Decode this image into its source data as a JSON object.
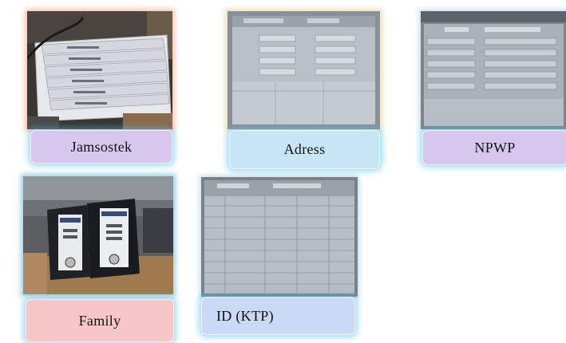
{
  "tiles": [
    {
      "label": "Jamsostek",
      "label_color": "#d7c7ee",
      "photo_icon": "document-stack-photo"
    },
    {
      "label": "Adress",
      "label_color": "#c6e6f6",
      "photo_icon": "address-form-screen-photo"
    },
    {
      "label": "NPWP",
      "label_color": "#d7c7ee",
      "photo_icon": "npwp-form-screen-photo"
    },
    {
      "label": "Family",
      "label_color": "#f7c7c7",
      "photo_icon": "binder-folders-photo"
    },
    {
      "label": "ID (KTP)",
      "label_color": "#c9d9f6",
      "photo_icon": "ktp-table-screen-photo"
    }
  ]
}
